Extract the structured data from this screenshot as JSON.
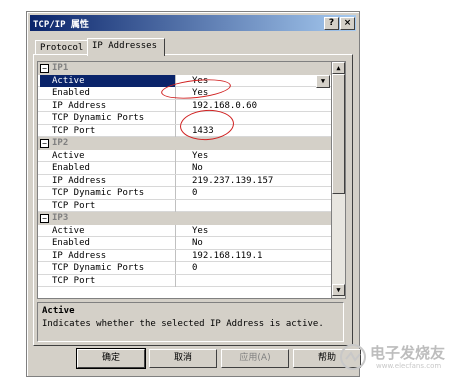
{
  "window": {
    "title": "TCP/IP 属性",
    "help_label": "?",
    "close_label": "×"
  },
  "tabs": [
    {
      "label": "Protocol"
    },
    {
      "label": "IP Addresses"
    }
  ],
  "groups": [
    {
      "name": "IP1",
      "expanded_label": "⊟",
      "props": [
        {
          "name": "Active",
          "value": "Yes"
        },
        {
          "name": "Enabled",
          "value": "Yes"
        },
        {
          "name": "IP Address",
          "value": "192.168.0.60"
        },
        {
          "name": "TCP Dynamic Ports",
          "value": ""
        },
        {
          "name": "TCP Port",
          "value": "1433"
        }
      ]
    },
    {
      "name": "IP2",
      "expanded_label": "⊟",
      "props": [
        {
          "name": "Active",
          "value": "Yes"
        },
        {
          "name": "Enabled",
          "value": "No"
        },
        {
          "name": "IP Address",
          "value": "219.237.139.157"
        },
        {
          "name": "TCP Dynamic Ports",
          "value": "0"
        },
        {
          "name": "TCP Port",
          "value": ""
        }
      ]
    },
    {
      "name": "IP3",
      "expanded_label": "⊟",
      "props": [
        {
          "name": "Active",
          "value": "Yes"
        },
        {
          "name": "Enabled",
          "value": "No"
        },
        {
          "name": "IP Address",
          "value": "192.168.119.1"
        },
        {
          "name": "TCP Dynamic Ports",
          "value": "0"
        },
        {
          "name": "TCP Port",
          "value": ""
        }
      ]
    }
  ],
  "description": {
    "title": "Active",
    "text": "Indicates whether the selected IP Address is active."
  },
  "buttons": {
    "ok": "确定",
    "cancel": "取消",
    "apply": "应用(A)",
    "help": "帮助"
  },
  "watermark": {
    "text": "电子发烧友",
    "domain": "www.elecfans.com"
  },
  "colors": {
    "titlebar_start": "#0a246a",
    "titlebar_end": "#a6caf0",
    "selection": "#0a246a",
    "annotation": "#d02020"
  }
}
